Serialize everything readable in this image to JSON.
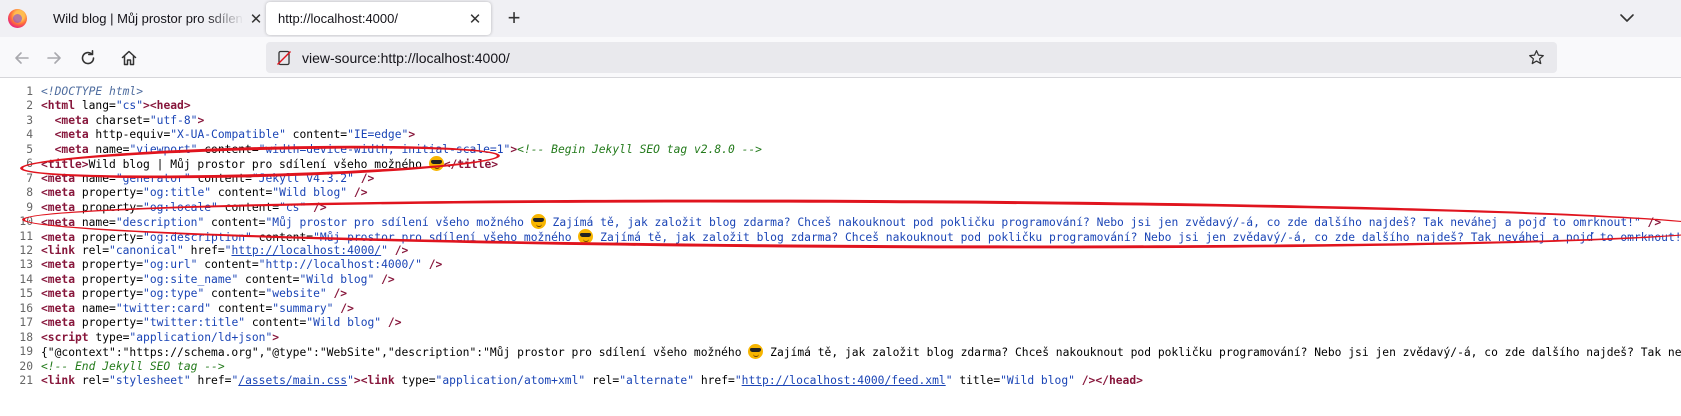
{
  "browser": {
    "tabs": [
      {
        "title": "Wild blog | Můj prostor pro sdílení všeho možného",
        "close": "✕"
      },
      {
        "title": "http://localhost:4000/",
        "close": "✕"
      }
    ],
    "new_tab": "+",
    "url": "view-source:http://localhost:4000/",
    "icons": {
      "browser_logo": "firefox-icon",
      "back": "arrow-left-icon",
      "forward": "arrow-right-icon",
      "reload": "reload-icon",
      "home": "home-icon",
      "page_info": "page-info-icon",
      "bookmark": "star-icon",
      "tab_list": "chevron-down-icon"
    }
  },
  "source": {
    "lines": [
      {
        "n": "1",
        "tokens": [
          {
            "t": "doctype",
            "v": "<!DOCTYPE html>"
          }
        ]
      },
      {
        "n": "2",
        "tokens": [
          {
            "t": "tag",
            "v": "<html"
          },
          {
            "t": "attr",
            "v": " lang="
          },
          {
            "t": "val",
            "v": "\"cs\""
          },
          {
            "t": "tag",
            "v": "><head>"
          }
        ]
      },
      {
        "n": "3",
        "tokens": [
          {
            "t": "text",
            "v": "  "
          },
          {
            "t": "tag",
            "v": "<meta"
          },
          {
            "t": "attr",
            "v": " charset="
          },
          {
            "t": "val",
            "v": "\"utf-8\""
          },
          {
            "t": "tag",
            "v": ">"
          }
        ]
      },
      {
        "n": "4",
        "tokens": [
          {
            "t": "text",
            "v": "  "
          },
          {
            "t": "tag",
            "v": "<meta"
          },
          {
            "t": "attr",
            "v": " http-equiv="
          },
          {
            "t": "val",
            "v": "\"X-UA-Compatible\""
          },
          {
            "t": "attr",
            "v": " content="
          },
          {
            "t": "val",
            "v": "\"IE=edge\""
          },
          {
            "t": "tag",
            "v": ">"
          }
        ]
      },
      {
        "n": "5",
        "tokens": [
          {
            "t": "text",
            "v": "  "
          },
          {
            "t": "tag",
            "v": "<meta"
          },
          {
            "t": "attr",
            "v": " name="
          },
          {
            "t": "val",
            "v": "\"viewport\""
          },
          {
            "t": "attr",
            "v": " content="
          },
          {
            "t": "val",
            "v": "\"width=device-width, initial-scale=1\""
          },
          {
            "t": "tag",
            "v": ">"
          },
          {
            "t": "comment",
            "v": "<!-- Begin Jekyll SEO tag v2.8.0 -->"
          }
        ]
      },
      {
        "n": "6",
        "tokens": [
          {
            "t": "tag",
            "v": "<title>"
          },
          {
            "t": "text",
            "v": "Wild blog | Můj prostor pro sdílení všeho možného "
          },
          {
            "t": "emoji",
            "v": "smiling-face-with-sunglasses"
          },
          {
            "t": "tag",
            "v": "</title>"
          }
        ]
      },
      {
        "n": "7",
        "tokens": [
          {
            "t": "tag",
            "v": "<meta"
          },
          {
            "t": "attr",
            "v": " name="
          },
          {
            "t": "val",
            "v": "\"generator\""
          },
          {
            "t": "attr",
            "v": " content="
          },
          {
            "t": "val",
            "v": "\"Jekyll v4.3.2\""
          },
          {
            "t": "tag",
            "v": " />"
          }
        ]
      },
      {
        "n": "8",
        "tokens": [
          {
            "t": "tag",
            "v": "<meta"
          },
          {
            "t": "attr",
            "v": " property="
          },
          {
            "t": "val",
            "v": "\"og:title\""
          },
          {
            "t": "attr",
            "v": " content="
          },
          {
            "t": "val",
            "v": "\"Wild blog\""
          },
          {
            "t": "tag",
            "v": " />"
          }
        ]
      },
      {
        "n": "9",
        "tokens": [
          {
            "t": "tag",
            "v": "<meta"
          },
          {
            "t": "attr",
            "v": " property="
          },
          {
            "t": "val",
            "v": "\"og:locale\""
          },
          {
            "t": "attr",
            "v": " content="
          },
          {
            "t": "val",
            "v": "\"cs\""
          },
          {
            "t": "tag",
            "v": " />"
          }
        ]
      },
      {
        "n": "10",
        "tokens": [
          {
            "t": "tag",
            "v": "<meta"
          },
          {
            "t": "attr",
            "v": " name="
          },
          {
            "t": "val",
            "v": "\"description\""
          },
          {
            "t": "attr",
            "v": " content="
          },
          {
            "t": "val",
            "v": "\"Můj prostor pro sdílení všeho možného "
          },
          {
            "t": "emoji",
            "v": "smiling-face-with-sunglasses"
          },
          {
            "t": "val",
            "v": " Zajímá tě, jak založit blog zdarma? Chceš nakouknout pod pokličku programování? Nebo jsi jen zvědavý/-á, co zde dalšího najdeš? Tak neváhej a pojď to omrknout!\""
          },
          {
            "t": "tag",
            "v": " />"
          }
        ]
      },
      {
        "n": "11",
        "tokens": [
          {
            "t": "tag",
            "v": "<meta"
          },
          {
            "t": "attr",
            "v": " property="
          },
          {
            "t": "val",
            "v": "\"og:description\""
          },
          {
            "t": "attr",
            "v": " content="
          },
          {
            "t": "val",
            "v": "\"Můj prostor pro sdílení všeho možného "
          },
          {
            "t": "emoji",
            "v": "smiling-face-with-sunglasses"
          },
          {
            "t": "val",
            "v": " Zajímá tě, jak založit blog zdarma? Chceš nakouknout pod pokličku programování? Nebo jsi jen zvědavý/-á, co zde dalšího najdeš? Tak neváhej a pojď to omrknout!\""
          },
          {
            "t": "tag",
            "v": " />"
          }
        ]
      },
      {
        "n": "12",
        "tokens": [
          {
            "t": "tag",
            "v": "<link"
          },
          {
            "t": "attr",
            "v": " rel="
          },
          {
            "t": "val",
            "v": "\"canonical\""
          },
          {
            "t": "attr",
            "v": " href="
          },
          {
            "t": "val",
            "v": "\""
          },
          {
            "t": "link",
            "v": "http://localhost:4000/"
          },
          {
            "t": "val",
            "v": "\""
          },
          {
            "t": "tag",
            "v": " />"
          }
        ]
      },
      {
        "n": "13",
        "tokens": [
          {
            "t": "tag",
            "v": "<meta"
          },
          {
            "t": "attr",
            "v": " property="
          },
          {
            "t": "val",
            "v": "\"og:url\""
          },
          {
            "t": "attr",
            "v": " content="
          },
          {
            "t": "val",
            "v": "\"http://localhost:4000/\""
          },
          {
            "t": "tag",
            "v": " />"
          }
        ]
      },
      {
        "n": "14",
        "tokens": [
          {
            "t": "tag",
            "v": "<meta"
          },
          {
            "t": "attr",
            "v": " property="
          },
          {
            "t": "val",
            "v": "\"og:site_name\""
          },
          {
            "t": "attr",
            "v": " content="
          },
          {
            "t": "val",
            "v": "\"Wild blog\""
          },
          {
            "t": "tag",
            "v": " />"
          }
        ]
      },
      {
        "n": "15",
        "tokens": [
          {
            "t": "tag",
            "v": "<meta"
          },
          {
            "t": "attr",
            "v": " property="
          },
          {
            "t": "val",
            "v": "\"og:type\""
          },
          {
            "t": "attr",
            "v": " content="
          },
          {
            "t": "val",
            "v": "\"website\""
          },
          {
            "t": "tag",
            "v": " />"
          }
        ]
      },
      {
        "n": "16",
        "tokens": [
          {
            "t": "tag",
            "v": "<meta"
          },
          {
            "t": "attr",
            "v": " name="
          },
          {
            "t": "val",
            "v": "\"twitter:card\""
          },
          {
            "t": "attr",
            "v": " content="
          },
          {
            "t": "val",
            "v": "\"summary\""
          },
          {
            "t": "tag",
            "v": " />"
          }
        ]
      },
      {
        "n": "17",
        "tokens": [
          {
            "t": "tag",
            "v": "<meta"
          },
          {
            "t": "attr",
            "v": " property="
          },
          {
            "t": "val",
            "v": "\"twitter:title\""
          },
          {
            "t": "attr",
            "v": " content="
          },
          {
            "t": "val",
            "v": "\"Wild blog\""
          },
          {
            "t": "tag",
            "v": " />"
          }
        ]
      },
      {
        "n": "18",
        "tokens": [
          {
            "t": "tag",
            "v": "<script"
          },
          {
            "t": "attr",
            "v": " type="
          },
          {
            "t": "val",
            "v": "\"application/ld+json\""
          },
          {
            "t": "tag",
            "v": ">"
          }
        ]
      },
      {
        "n": "19",
        "tokens": [
          {
            "t": "text",
            "v": "{\"@context\":\"https://schema.org\",\"@type\":\"WebSite\",\"description\":\"Můj prostor pro sdílení všeho možného "
          },
          {
            "t": "emoji",
            "v": "smiling-face-with-sunglasses"
          },
          {
            "t": "text",
            "v": " Zajímá tě, jak založit blog zdarma? Chceš nakouknout pod pokličku programování? Nebo jsi jen zvědavý/-á, co zde dalšího najdeš? Tak neváhej a pojď to omrknout!\"}"
          }
        ]
      },
      {
        "n": "20",
        "tokens": [
          {
            "t": "comment",
            "v": "<!-- End Jekyll SEO tag -->"
          }
        ]
      },
      {
        "n": "21",
        "tokens": [
          {
            "t": "tag",
            "v": "<link"
          },
          {
            "t": "attr",
            "v": " rel="
          },
          {
            "t": "val",
            "v": "\"stylesheet\""
          },
          {
            "t": "attr",
            "v": " href="
          },
          {
            "t": "val",
            "v": "\""
          },
          {
            "t": "link",
            "v": "/assets/main.css"
          },
          {
            "t": "val",
            "v": "\""
          },
          {
            "t": "tag",
            "v": "><link"
          },
          {
            "t": "attr",
            "v": " type="
          },
          {
            "t": "val",
            "v": "\"application/atom+xml\""
          },
          {
            "t": "attr",
            "v": " rel="
          },
          {
            "t": "val",
            "v": "\"alternate\""
          },
          {
            "t": "attr",
            "v": " href="
          },
          {
            "t": "val",
            "v": "\""
          },
          {
            "t": "link",
            "v": "http://localhost:4000/feed.xml"
          },
          {
            "t": "val",
            "v": "\""
          },
          {
            "t": "attr",
            "v": " title="
          },
          {
            "t": "val",
            "v": "\"Wild blog\""
          },
          {
            "t": "tag",
            "v": " /></head>"
          }
        ]
      }
    ]
  },
  "annotations": {
    "color": "#e0141e",
    "highlighted_lines": [
      "6",
      "10",
      "11"
    ]
  }
}
